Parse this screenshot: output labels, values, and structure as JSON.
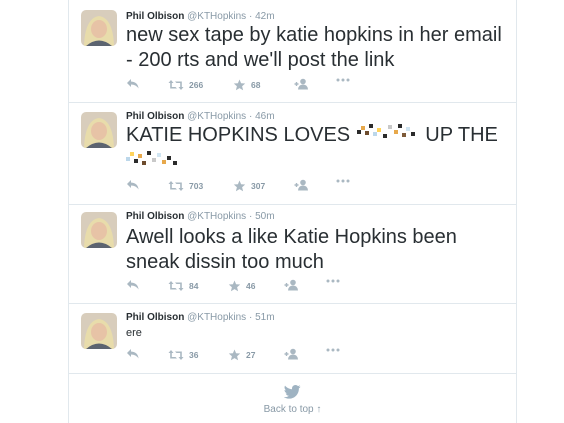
{
  "tweets": [
    {
      "name": "Phil Olbison",
      "handle": "@KTHopkins",
      "time": "42m",
      "text": "new sex tape by katie hopkins in her email - 200 rts and we'll post the link",
      "retweets": "266",
      "favorites": "68"
    },
    {
      "name": "Phil Olbison",
      "handle": "@KTHopkins",
      "time": "46m",
      "text_part1": "KATIE HOPKINS LOVES",
      "text_part2": "UP THE",
      "retweets": "703",
      "favorites": "307"
    },
    {
      "name": "Phil Olbison",
      "handle": "@KTHopkins",
      "time": "50m",
      "text": "Awell looks a like Katie Hopkins been sneak dissin too much",
      "retweets": "84",
      "favorites": "46"
    },
    {
      "name": "Phil Olbison",
      "handle": "@KTHopkins",
      "time": "51m",
      "text": "ere",
      "retweets": "36",
      "favorites": "27"
    }
  ],
  "footer": {
    "back_to_top": "Back to top ↑"
  },
  "colors": {
    "accent": "#55acee",
    "text": "#292f33",
    "muted": "#8899a6",
    "icon": "#aab8c2",
    "border": "#e1e8ed"
  },
  "icons": [
    "reply-icon",
    "retweet-icon",
    "favorite-icon",
    "follow-icon",
    "more-icon",
    "twitter-bird-icon",
    "pixelated-emoji-icon"
  ]
}
